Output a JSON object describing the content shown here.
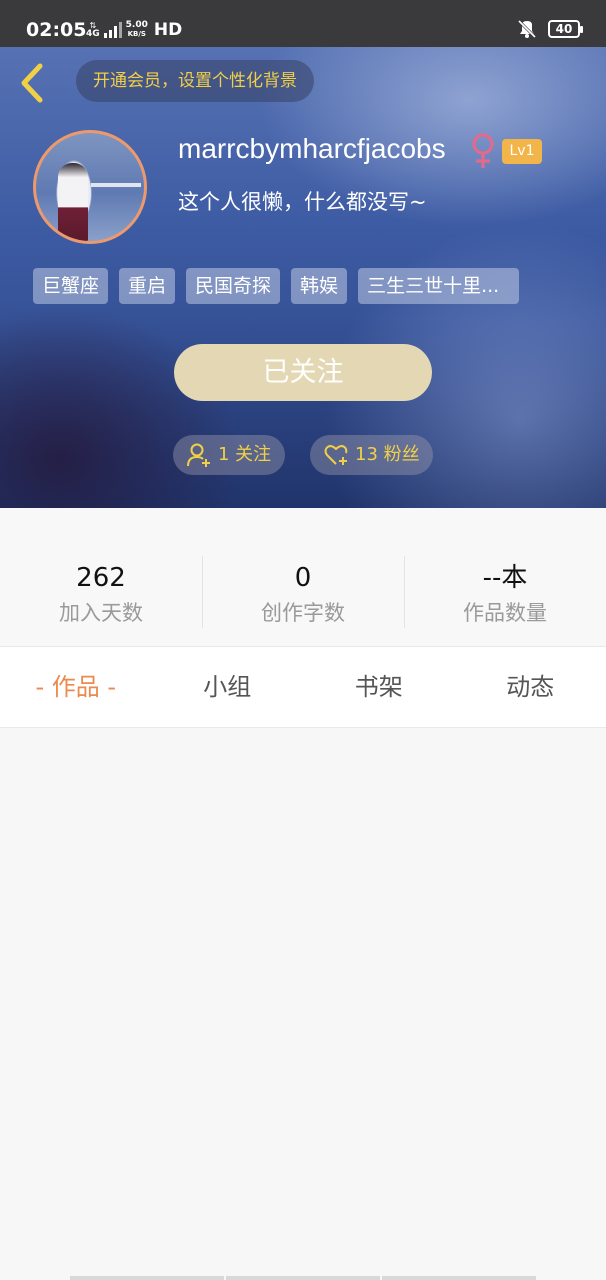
{
  "status_bar": {
    "time": "02:05",
    "network": "4G",
    "speed_value": "5.00",
    "speed_unit": "KB/S",
    "hd": "HD",
    "battery": "40"
  },
  "header": {
    "vip_prompt": "开通会员，设置个性化背景",
    "username": "marrcbymharcfjacobs",
    "level": "Lv1",
    "bio": "这个人很懒，什么都没写~",
    "tags": [
      "巨蟹座",
      "重启",
      "民国奇探",
      "韩娱",
      "三生三世十里..."
    ],
    "follow_button": "已关注",
    "following_text": "1 关注",
    "fans_text": "13 粉丝"
  },
  "stats": [
    {
      "value": "262",
      "label": "加入天数"
    },
    {
      "value": "0",
      "label": "创作字数"
    },
    {
      "value": "--本",
      "label": "作品数量"
    }
  ],
  "tabs": [
    "- 作品 -",
    "小组",
    "书架",
    "动态"
  ],
  "icons": {
    "back": "chevron-left-icon",
    "gender": "female-icon",
    "following": "user-add-icon",
    "fans": "heart-add-icon"
  },
  "colors": {
    "accent_yellow": "#f1d046",
    "active_tab": "#ea8a4f",
    "level_badge": "#f2b54a",
    "follow_button": "#e3d7b4",
    "female": "#e26a8d"
  }
}
